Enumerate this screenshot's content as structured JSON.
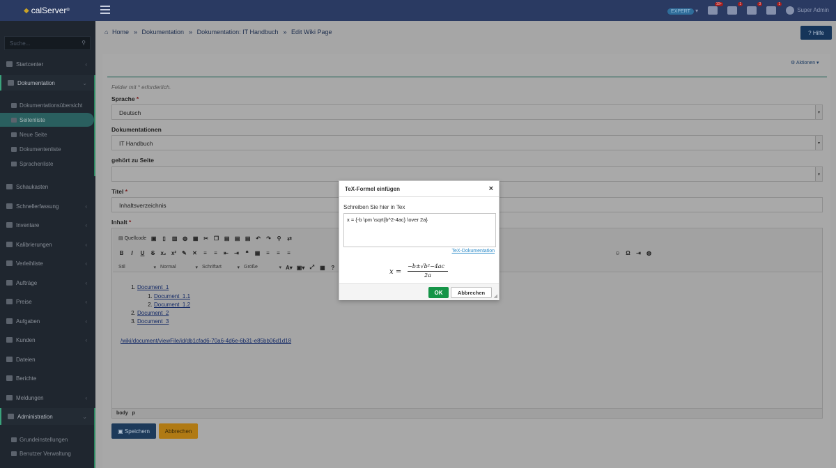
{
  "app": {
    "brand": "calServer",
    "brand_mark": "®"
  },
  "topbar": {
    "expert_label": "EXPERT",
    "badges": [
      "10+",
      "1",
      "3",
      "1"
    ],
    "user": "Super Admin"
  },
  "sidebar": {
    "search_placeholder": "Suche...",
    "items": [
      {
        "label": "Startcenter"
      },
      {
        "label": "Dokumentation"
      },
      {
        "label": "Schaukasten"
      },
      {
        "label": "Schnellerfassung"
      },
      {
        "label": "Inventare"
      },
      {
        "label": "Kalibrierungen"
      },
      {
        "label": "Verleihliste"
      },
      {
        "label": "Aufträge"
      },
      {
        "label": "Preise"
      },
      {
        "label": "Aufgaben"
      },
      {
        "label": "Kunden"
      },
      {
        "label": "Dateien"
      },
      {
        "label": "Berichte"
      },
      {
        "label": "Meldungen"
      },
      {
        "label": "Administration"
      }
    ],
    "doc_sub": [
      "Dokumentationsübersicht",
      "Seitenliste",
      "Neue Seite",
      "Dokumentenliste",
      "Sprachenliste"
    ],
    "admin_sub": [
      "Grundeinstellungen",
      "Benutzer Verwaltung"
    ]
  },
  "breadcrumb": [
    "Home",
    "Dokumentation",
    "Dokumentation: IT Handbuch",
    "Edit Wiki Page"
  ],
  "help_label": "Hilfe",
  "aktionen_label": "Aktionen",
  "form": {
    "required_note": "Felder mit * erforderlich.",
    "sprache_label": "Sprache",
    "sprache_value": "Deutsch",
    "dok_label": "Dokumentationen",
    "dok_value": "IT Handbuch",
    "parent_label": "gehört zu Seite",
    "parent_value": "",
    "titel_label": "Titel",
    "titel_value": "Inhaltsverzeichnis",
    "inhalt_label": "Inhalt",
    "save_label": "Speichern",
    "cancel_label": "Abbrechen"
  },
  "editor": {
    "quellcode": "Quellcode",
    "styles": [
      "Stil",
      "Normal",
      "Schriftart",
      "Größe"
    ],
    "list": [
      "Document_1",
      "Document_1.1",
      "Document_1.2",
      "Document_2",
      "Document_3"
    ],
    "url": "/wiki/document/viewFile/id/db1cfad6-70a6-4d6e-6b31-e85bb06d1d18",
    "path": [
      "body",
      "p"
    ]
  },
  "modal": {
    "title": "TeX-Formel einfügen",
    "label": "Schreiben Sie hier in Tex",
    "tex": "x = {-b \\pm \\sqrt{b^2-4ac} \\over 2a}",
    "doc_link": "TeX-Dokumentation",
    "ok_label": "OK",
    "cancel_label": "Abbrechen"
  }
}
